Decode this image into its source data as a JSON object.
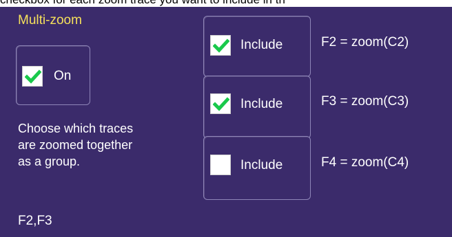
{
  "caption": {
    "text": "checkbox for each zoom trace you want to include in th"
  },
  "panel": {
    "title": "Multi-zoom",
    "title_color": "#f5e05b",
    "background_color": "#3b2b6b"
  },
  "multizoom": {
    "on_label": "On",
    "checked": true,
    "check_color": "#19c94b"
  },
  "help": {
    "lines": [
      "Choose which traces",
      "are zoomed together",
      "as a group."
    ]
  },
  "group": {
    "text": "F2,F3"
  },
  "traces": [
    {
      "include_label": "Include",
      "checked": true,
      "formula": "F2 = zoom(C2)"
    },
    {
      "include_label": "Include",
      "checked": true,
      "formula": "F3 = zoom(C3)"
    },
    {
      "include_label": "Include",
      "checked": false,
      "formula": "F4 = zoom(C4)"
    }
  ]
}
